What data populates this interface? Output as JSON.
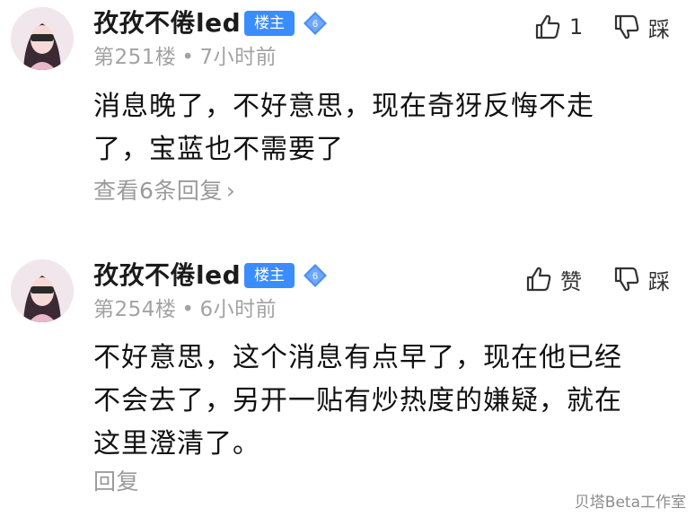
{
  "posts": [
    {
      "username": "孜孜不倦led",
      "host_badge": "楼主",
      "level": "6",
      "floor": "第251楼",
      "time": "7小时前",
      "like_label": "1",
      "dislike_label": "踩",
      "content_lines": [
        "消息晚了，不好意思，现在奇犽反悔不走",
        "了，宝蓝也不需要了"
      ],
      "reply_link": "查看6条回复",
      "reply_chevron": "›"
    },
    {
      "username": "孜孜不倦led",
      "host_badge": "楼主",
      "level": "6",
      "floor": "第254楼",
      "time": "6小时前",
      "like_label": "赞",
      "dislike_label": "踩",
      "content_lines": [
        "不好意思，这个消息有点早了，现在他已经",
        "不会去了，另开一贴有炒热度的嫌疑，就在",
        "这里澄清了。"
      ],
      "reply_link": "回复",
      "reply_chevron": ""
    }
  ],
  "meta_separator": "•",
  "watermark": "贝塔Beta工作室",
  "icons": {
    "like": "thumbs-up-icon",
    "dislike": "thumbs-down-icon",
    "level": "diamond-level-icon",
    "avatar": "avatar"
  },
  "colors": {
    "host_badge": "#3a8dff",
    "level_badge": "#4b8ff5",
    "meta": "#a3a3a3",
    "reply_link": "#9a9a9a"
  }
}
